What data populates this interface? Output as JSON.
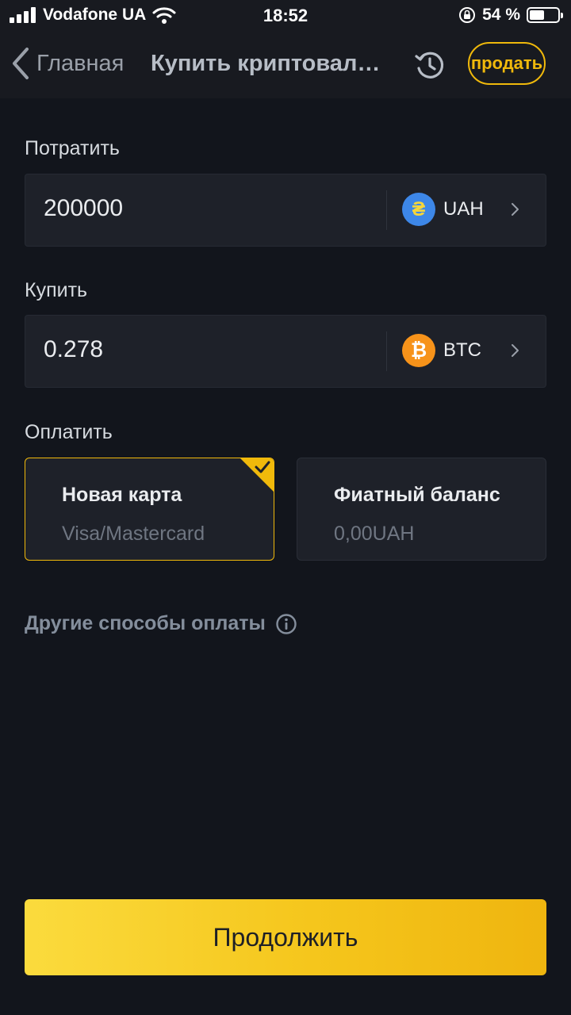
{
  "status_bar": {
    "carrier": "Vodafone UA",
    "time": "18:52",
    "battery_percent": "54 %",
    "battery_level": 0.54
  },
  "nav": {
    "back_label": "Главная",
    "title": "Купить криптовалюту",
    "sell_label": "продать"
  },
  "spend": {
    "label": "Потратить",
    "amount": "200000",
    "currency": "UAH",
    "currency_symbol": "₴"
  },
  "buy": {
    "label": "Купить",
    "amount": "0.278",
    "currency": "BTC",
    "currency_symbol": "₿"
  },
  "payment": {
    "label": "Оплатить",
    "options": [
      {
        "title": "Новая карта",
        "subtitle": "Visa/Mastercard",
        "selected": true
      },
      {
        "title": "Фиатный баланс",
        "subtitle": "0,00UAH",
        "selected": false
      }
    ]
  },
  "other_methods_label": "Другие способы оплаты",
  "continue_label": "Продолжить",
  "colors": {
    "accent": "#f0b90b",
    "background": "#12151c",
    "card": "#1e2129"
  }
}
